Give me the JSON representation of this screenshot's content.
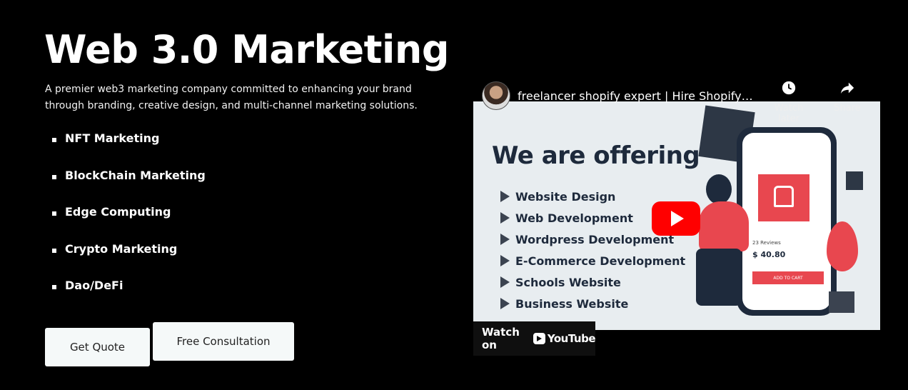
{
  "hero": {
    "title": "Web 3.0 Marketing",
    "description": "A premier web3 marketing company committed to enhancing your brand through branding, creative design, and multi-channel marketing solutions."
  },
  "services": [
    {
      "label": "NFT Marketing"
    },
    {
      "label": "BlockChain Marketing"
    },
    {
      "label": "Edge Computing"
    },
    {
      "label": "Crypto Marketing"
    },
    {
      "label": "Dao/DeFi"
    }
  ],
  "buttons": {
    "quote": "Get Quote",
    "consultation": "Free Consultation"
  },
  "video": {
    "title": "freelancer shopify expert | Hire Shopify ...",
    "watch_later": "Watch later",
    "share": "Share",
    "thumbnail": {
      "heading": "We are offering",
      "items": [
        {
          "label": "Website Design"
        },
        {
          "label": "Web Development"
        },
        {
          "label": "Wordpress Development"
        },
        {
          "label": "E-Commerce Development"
        },
        {
          "label": "Schools Website"
        },
        {
          "label": "Business Website"
        }
      ],
      "reviews": "23 Reviews",
      "price": "$ 40.80",
      "add_to_cart": "ADD TO CART"
    },
    "watch_on": "Watch on",
    "youtube": "YouTube",
    "colors": {
      "accent": "#e8474f",
      "youtube_red": "#ff0000",
      "navy": "#1e2a3c"
    }
  }
}
